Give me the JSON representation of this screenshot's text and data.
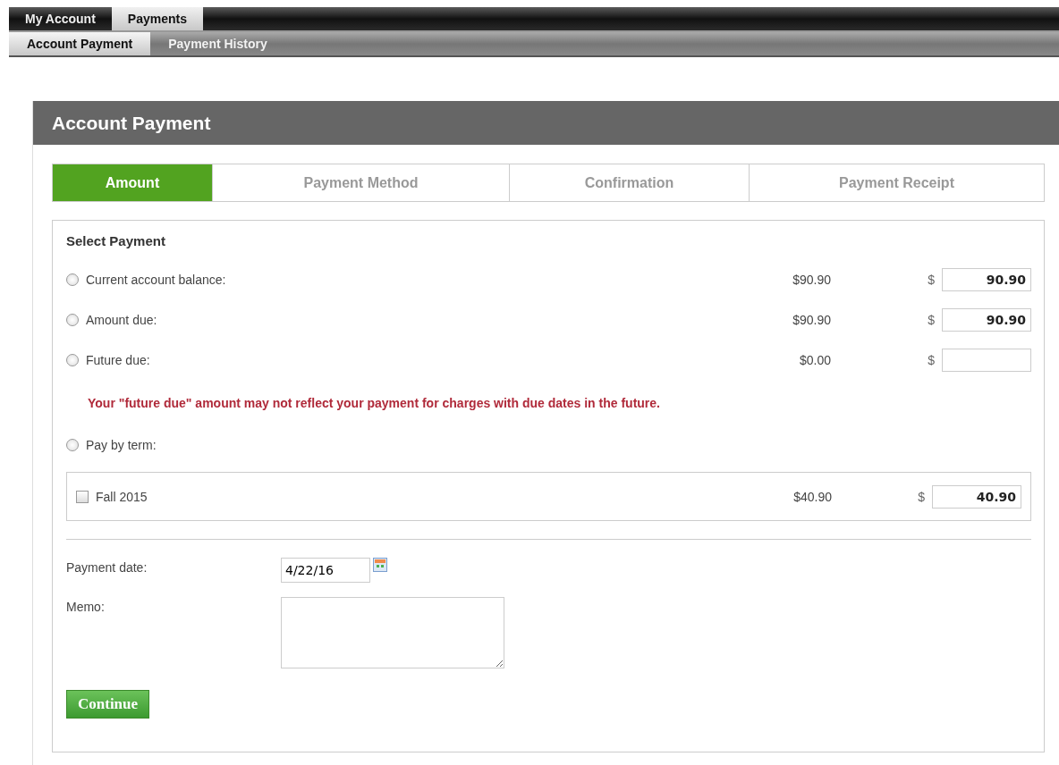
{
  "top_nav": [
    {
      "label": "My Account",
      "selected": false
    },
    {
      "label": "Payments",
      "selected": true
    }
  ],
  "sub_nav": [
    {
      "label": "Account Payment",
      "selected": true
    },
    {
      "label": "Payment History",
      "selected": false
    }
  ],
  "panel": {
    "title": "Account Payment"
  },
  "steps": [
    {
      "label": "Amount",
      "selected": true
    },
    {
      "label": "Payment Method",
      "selected": false
    },
    {
      "label": "Confirmation",
      "selected": false
    },
    {
      "label": "Payment Receipt",
      "selected": false
    }
  ],
  "select_payment": {
    "heading": "Select Payment",
    "options": [
      {
        "label": "Current account balance:",
        "amount": "$90.90",
        "currency": "$",
        "value": "90.90",
        "selected": false
      },
      {
        "label": "Amount due:",
        "amount": "$90.90",
        "currency": "$",
        "value": "90.90",
        "selected": false
      },
      {
        "label": "Future due:",
        "amount": "$0.00",
        "currency": "$",
        "selected": false
      }
    ],
    "warning": "Your \"future due\" amount may not reflect your payment for charges with due dates in the future.",
    "term_option": {
      "label": "Pay by term:",
      "selected": false
    },
    "terms": [
      {
        "label": "Fall 2015",
        "checked": false,
        "amount": "$40.90",
        "currency": "$",
        "value": "40.90"
      }
    ]
  },
  "payment_date": {
    "label": "Payment date:",
    "value": "4/22/16"
  },
  "memo": {
    "label": "Memo:"
  },
  "continue_button": "Continue"
}
